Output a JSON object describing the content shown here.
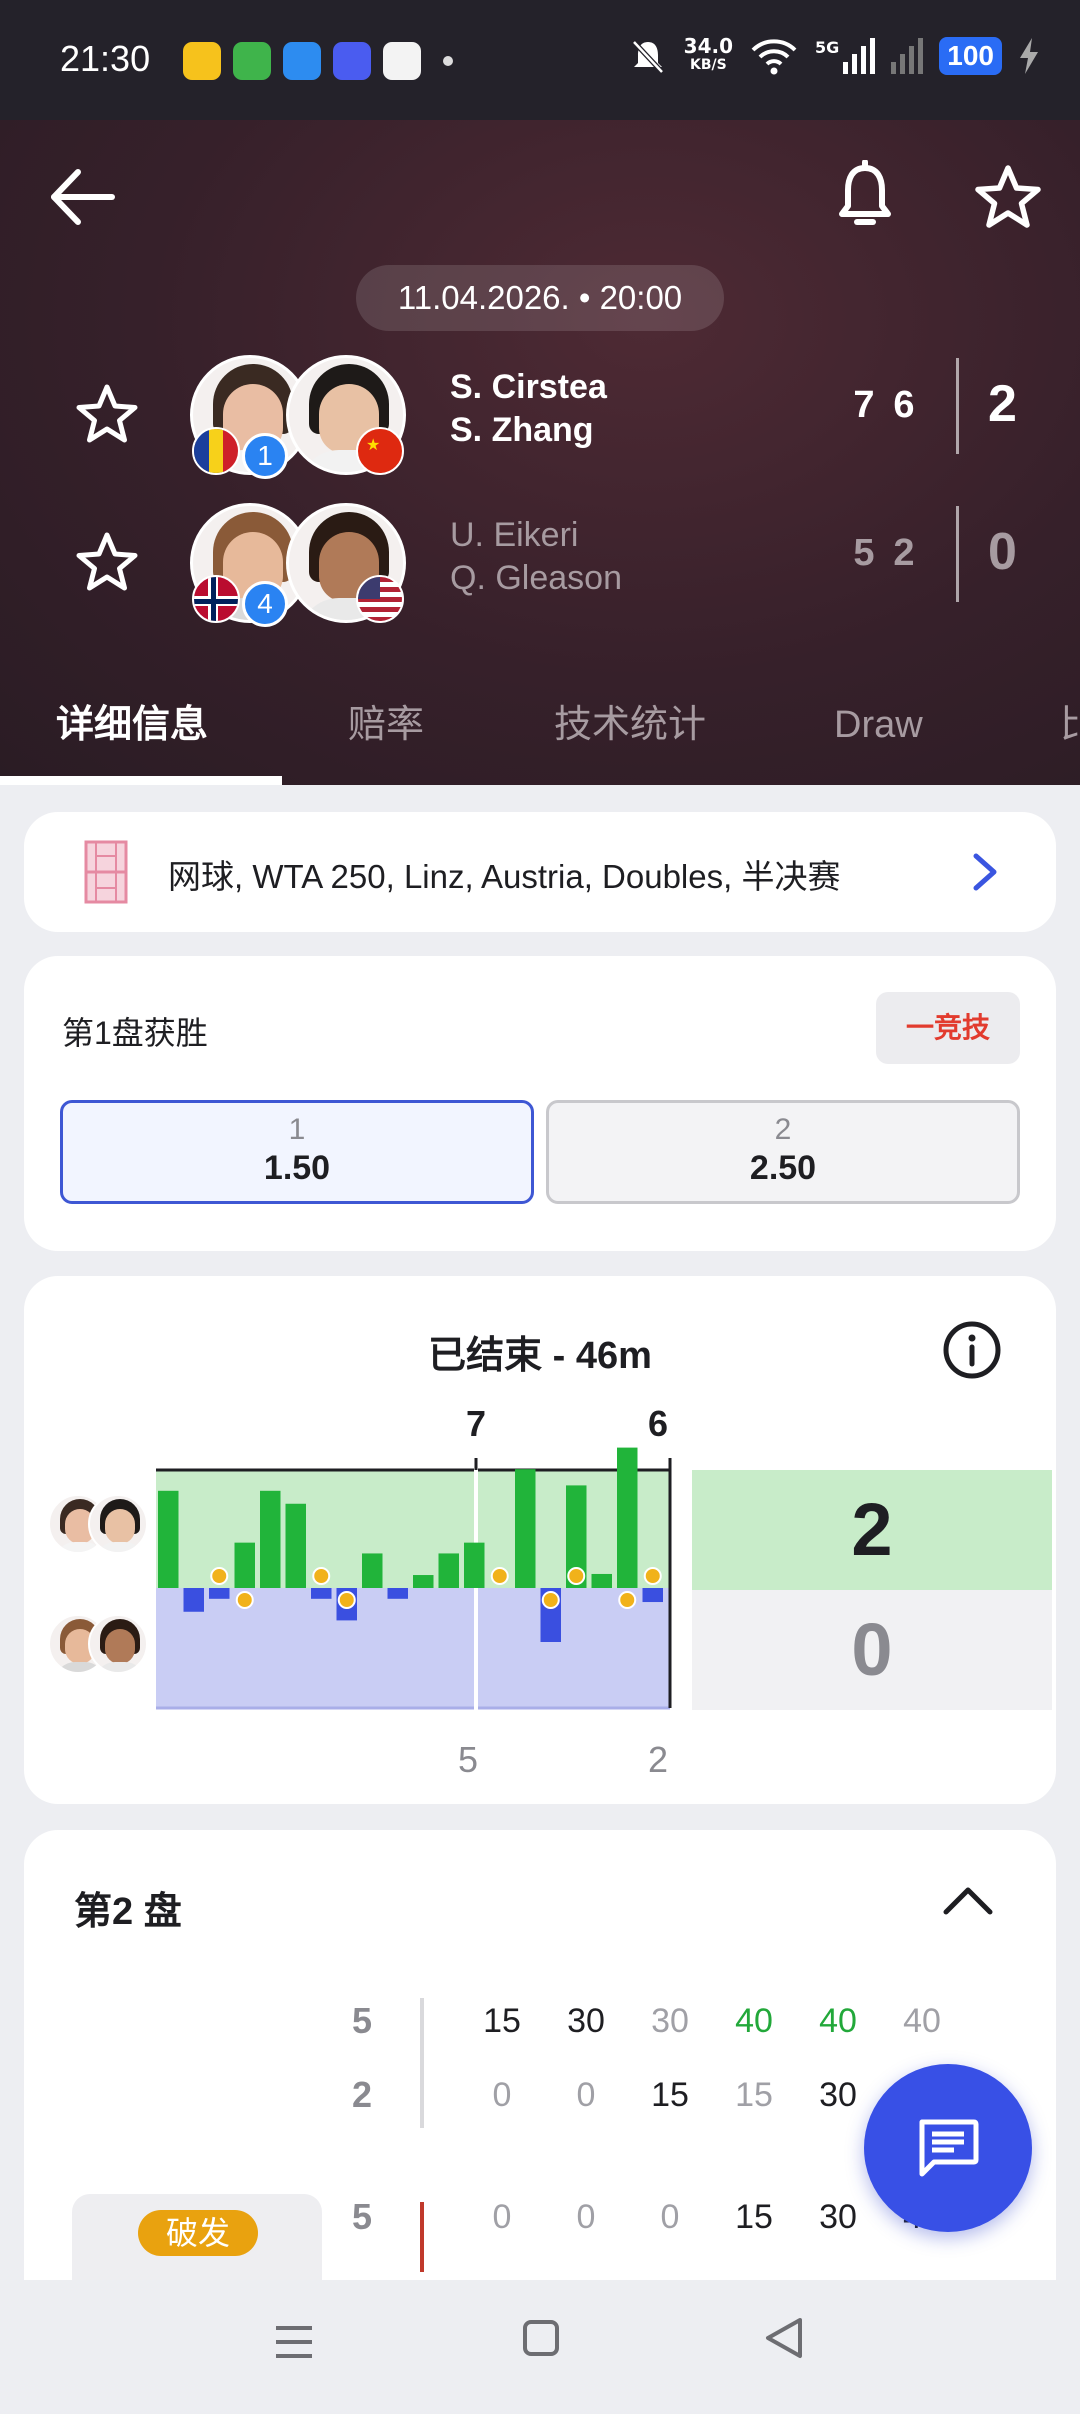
{
  "status_bar": {
    "time": "21:30",
    "net_speed_value": "34.0",
    "net_speed_unit": "KB/S",
    "network": "5G",
    "battery": "100"
  },
  "header": {
    "datetime": "11.04.2026. • 20:00",
    "team1": {
      "player1": "S. Cirstea",
      "player2": "S. Zhang",
      "seed": "1",
      "sets": [
        "7",
        "6"
      ],
      "total": "2"
    },
    "team2": {
      "player1": "U. Eikeri",
      "player2": "Q. Gleason",
      "seed": "4",
      "sets": [
        "5",
        "2"
      ],
      "total": "0"
    }
  },
  "tabs": [
    "详细信息",
    "赔率",
    "技术统计",
    "Draw",
    "比"
  ],
  "tournament": {
    "text": "网球, WTA 250, Linz, Austria, Doubles, 半决赛"
  },
  "odds": {
    "title": "第1盘获胜",
    "brand": "一竞技",
    "options": [
      {
        "label": "1",
        "value": "1.50"
      },
      {
        "label": "2",
        "value": "2.50"
      }
    ]
  },
  "momentum": {
    "title": "已结束 - 46m",
    "set_scores_top": [
      "7",
      "6"
    ],
    "set_scores_bottom": [
      "5",
      "2"
    ],
    "final_top": "2",
    "final_bottom": "0",
    "colors": {
      "team1": "#21b43a",
      "team1_bg": "#c8ecc9",
      "team2": "#3a4fe0",
      "team2_bg": "#c9cdf4"
    }
  },
  "chart_data": {
    "type": "bar",
    "title": "已结束 - 46m",
    "series": [
      {
        "name": "S. Cirstea / S. Zhang",
        "values": [
          0.9,
          0,
          0,
          0.42,
          0.9,
          0.78,
          0,
          0,
          0.32,
          0,
          0.12,
          0.32,
          0.42,
          0,
          1.1,
          0,
          0.95,
          0.13,
          1.3,
          0
        ]
      },
      {
        "name": "U. Eikeri / Q. Gleason",
        "values": [
          0,
          -0.22,
          -0.1,
          0,
          0,
          0,
          -0.1,
          -0.3,
          0,
          -0.1,
          0,
          0,
          0,
          0,
          0,
          -0.5,
          0,
          0,
          0,
          -0.13
        ]
      }
    ],
    "break_markers": [
      2,
      3,
      6,
      7,
      13,
      15,
      16,
      18,
      19
    ]
  },
  "set2": {
    "title": "第2 盘",
    "rows": [
      {
        "games": "5",
        "points": [
          "15",
          "30",
          "30",
          "40",
          "40",
          "40"
        ],
        "styles": [
          "n",
          "n",
          "d",
          "g",
          "g",
          "d"
        ]
      },
      {
        "games": "2",
        "points": [
          "0",
          "0",
          "15",
          "15",
          "30",
          "40"
        ],
        "styles": [
          "d",
          "d",
          "n",
          "d",
          "n",
          "n"
        ]
      },
      {
        "games": "5",
        "points": [
          "0",
          "0",
          "0",
          "15",
          "30",
          "40"
        ],
        "styles": [
          "d",
          "d",
          "d",
          "n",
          "n",
          "n"
        ]
      }
    ],
    "break_label": "破发"
  }
}
